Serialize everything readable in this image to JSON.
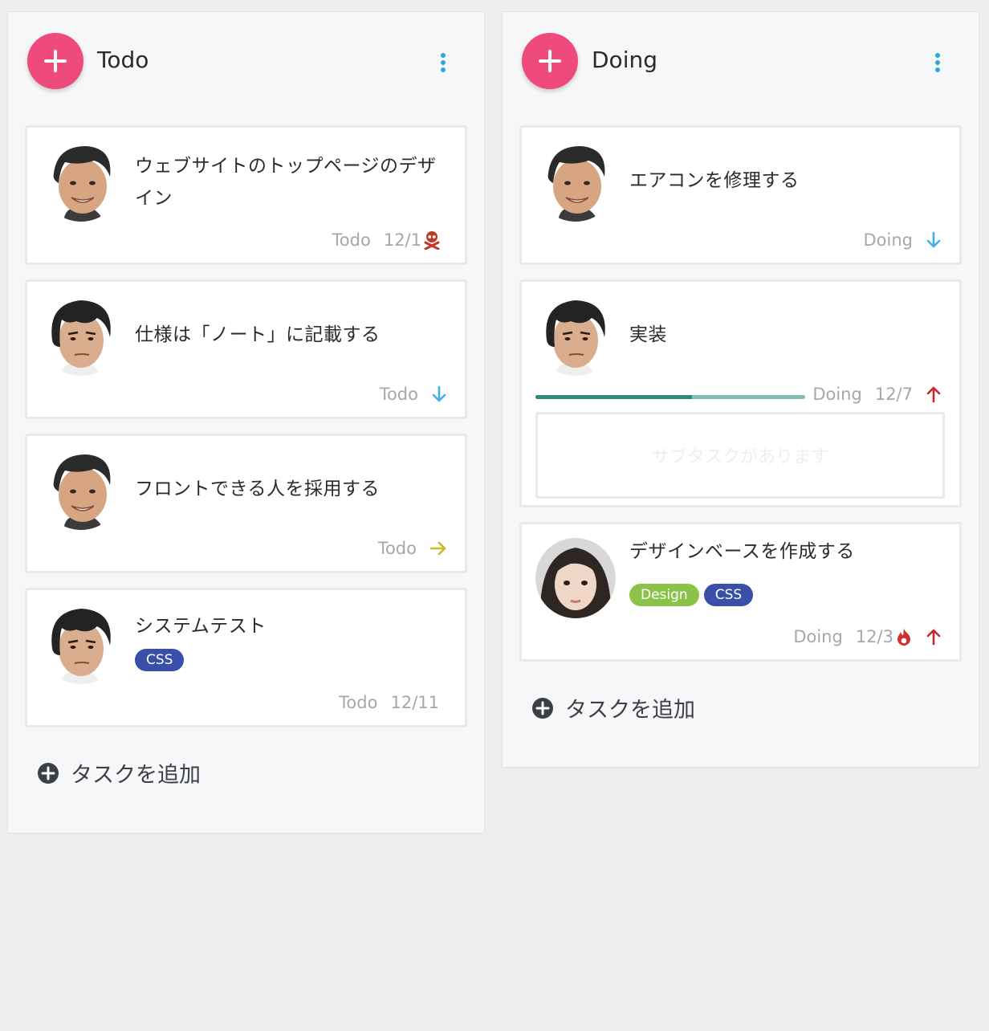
{
  "columns": [
    {
      "title": "Todo",
      "add_task_label": "タスクを追加",
      "cards": [
        {
          "title_line1": "ウェブサイトのトップページのデザ",
          "title_line2": "イン",
          "status": "Todo",
          "date": "12/1",
          "icon": "skull-icon"
        },
        {
          "title": "仕様は「ノート」に記載する",
          "status": "Todo",
          "icon": "arrow-down-icon"
        },
        {
          "title": "フロントできる人を採用する",
          "status": "Todo",
          "icon": "arrow-right-icon"
        },
        {
          "title": "システムテスト",
          "tags": [
            "CSS"
          ],
          "status": "Todo",
          "date": "12/11"
        }
      ]
    },
    {
      "title": "Doing",
      "add_task_label": "タスクを追加",
      "cards": [
        {
          "title": "エアコンを修理する",
          "status": "Doing",
          "icon": "arrow-down-icon"
        },
        {
          "title": "実装",
          "status": "Doing",
          "date": "12/7",
          "icon": "arrow-up-icon",
          "progress": 0.58,
          "subtask_placeholder": "サブタスクがあります"
        },
        {
          "title": "デザインベースを作成する",
          "tags": [
            "Design",
            "CSS"
          ],
          "status": "Doing",
          "date": "12/3",
          "icon": "arrow-up-icon",
          "date_icon": "fire-icon"
        }
      ]
    }
  ],
  "colors": {
    "fab": "#ee4a7b",
    "kebab": "#2aa6e0",
    "priority_low": "#3fb0e8",
    "priority_mid": "#c9b92e",
    "priority_high": "#c62828",
    "tag_css": "#3a4fa8",
    "tag_design": "#8bc34a",
    "progress_fill": "#2e8b7b",
    "progress_track": "#80c0b4"
  }
}
